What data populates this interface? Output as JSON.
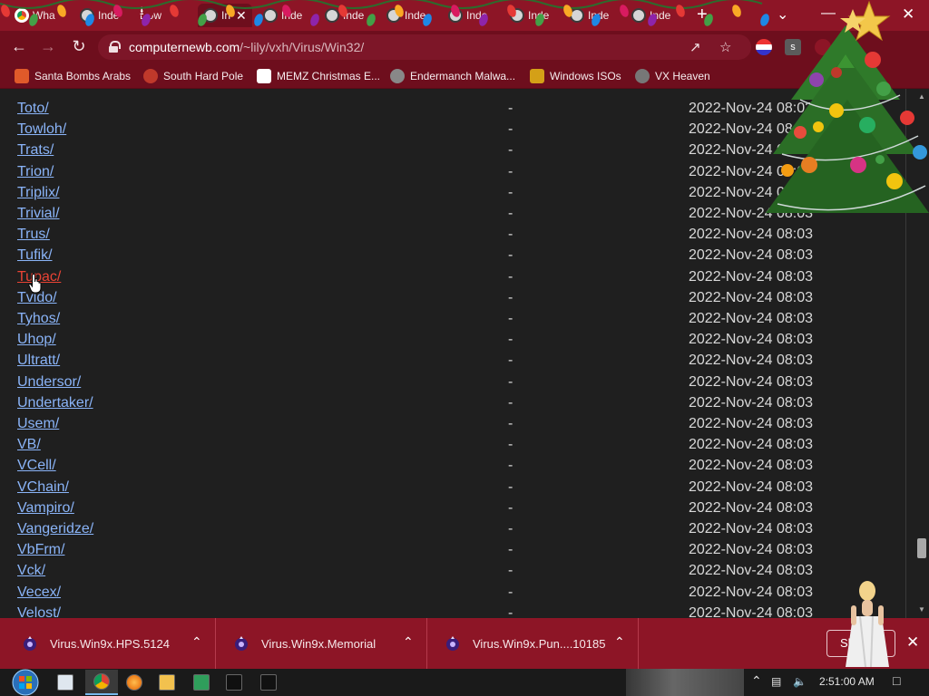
{
  "tabs": [
    {
      "title": "Wha",
      "icon": "chrome-icon"
    },
    {
      "title": "Inde",
      "icon": "shield-skull-icon"
    },
    {
      "title": "Dow",
      "icon": "download-icon"
    },
    {
      "title": "In",
      "icon": "shield-skull-icon",
      "active": true
    },
    {
      "title": "Inde",
      "icon": "shield-skull-icon"
    },
    {
      "title": "Inde",
      "icon": "shield-skull-icon"
    },
    {
      "title": "Inde",
      "icon": "shield-skull-icon"
    },
    {
      "title": "Inde",
      "icon": "shield-skull-icon"
    },
    {
      "title": "Inde",
      "icon": "shield-skull-icon"
    },
    {
      "title": "Inde",
      "icon": "shield-skull-icon"
    },
    {
      "title": "Inde",
      "icon": "shield-skull-icon"
    }
  ],
  "address": {
    "host": "computernewb.com",
    "path": "/~lily/vxh/Virus/Win32/"
  },
  "bookmarks": [
    {
      "label": "Santa Bombs Arabs",
      "icon": "flame-icon"
    },
    {
      "label": "South Hard Pole",
      "icon": "snowflake-icon"
    },
    {
      "label": "MEMZ Christmas E...",
      "icon": "page-icon"
    },
    {
      "label": "Endermanch Malwa...",
      "icon": "raccoon-icon"
    },
    {
      "label": "Windows ISOs",
      "icon": "person-icon"
    },
    {
      "label": "VX Heaven",
      "icon": "shield-skull-icon"
    }
  ],
  "listing": [
    {
      "name": "Toto/",
      "size": "-",
      "date": "2022-Nov-24 08:03"
    },
    {
      "name": "Towloh/",
      "size": "-",
      "date": "2022-Nov-24 08:03"
    },
    {
      "name": "Trats/",
      "size": "-",
      "date": "2022-Nov-24 08:03"
    },
    {
      "name": "Trion/",
      "size": "-",
      "date": "2022-Nov-24 08:03"
    },
    {
      "name": "Triplix/",
      "size": "-",
      "date": "2022-Nov-24 08:03"
    },
    {
      "name": "Trivial/",
      "size": "-",
      "date": "2022-Nov-24 08:03"
    },
    {
      "name": "Trus/",
      "size": "-",
      "date": "2022-Nov-24 08:03"
    },
    {
      "name": "Tufik/",
      "size": "-",
      "date": "2022-Nov-24 08:03"
    },
    {
      "name": "Tupac/",
      "size": "-",
      "date": "2022-Nov-24 08:03",
      "hover": true
    },
    {
      "name": "Tvido/",
      "size": "-",
      "date": "2022-Nov-24 08:03"
    },
    {
      "name": "Tyhos/",
      "size": "-",
      "date": "2022-Nov-24 08:03"
    },
    {
      "name": "Uhop/",
      "size": "-",
      "date": "2022-Nov-24 08:03"
    },
    {
      "name": "Ultratt/",
      "size": "-",
      "date": "2022-Nov-24 08:03"
    },
    {
      "name": "Undersor/",
      "size": "-",
      "date": "2022-Nov-24 08:03"
    },
    {
      "name": "Undertaker/",
      "size": "-",
      "date": "2022-Nov-24 08:03"
    },
    {
      "name": "Usem/",
      "size": "-",
      "date": "2022-Nov-24 08:03"
    },
    {
      "name": "VB/",
      "size": "-",
      "date": "2022-Nov-24 08:03"
    },
    {
      "name": "VCell/",
      "size": "-",
      "date": "2022-Nov-24 08:03"
    },
    {
      "name": "VChain/",
      "size": "-",
      "date": "2022-Nov-24 08:03"
    },
    {
      "name": "Vampiro/",
      "size": "-",
      "date": "2022-Nov-24 08:03"
    },
    {
      "name": "Vangeridze/",
      "size": "-",
      "date": "2022-Nov-24 08:03"
    },
    {
      "name": "VbFrm/",
      "size": "-",
      "date": "2022-Nov-24 08:03"
    },
    {
      "name": "Vck/",
      "size": "-",
      "date": "2022-Nov-24 08:03"
    },
    {
      "name": "Vecex/",
      "size": "-",
      "date": "2022-Nov-24 08:03"
    },
    {
      "name": "Velost/",
      "size": "-",
      "date": "2022-Nov-24 08:03"
    }
  ],
  "downloads": [
    {
      "name": "Virus.Win9x.HPS.5124"
    },
    {
      "name": "Virus.Win9x.Memorial"
    },
    {
      "name": "Virus.Win9x.Pun....10185"
    }
  ],
  "show_all_label": "Sh",
  "taskbar": {
    "clock": "2:51:00 AM",
    "apps": [
      "explorer-icon",
      "chrome-icon",
      "firefox-icon",
      "folder-icon",
      "cheat-engine-icon",
      "cmd-icon",
      "7zip-icon"
    ]
  },
  "colors": {
    "frame": "#8d1526",
    "toolbar": "#6e0e1d",
    "link": "#8ab4f8",
    "link_hover": "#ea4335",
    "page_bg": "#1f1f1f"
  }
}
